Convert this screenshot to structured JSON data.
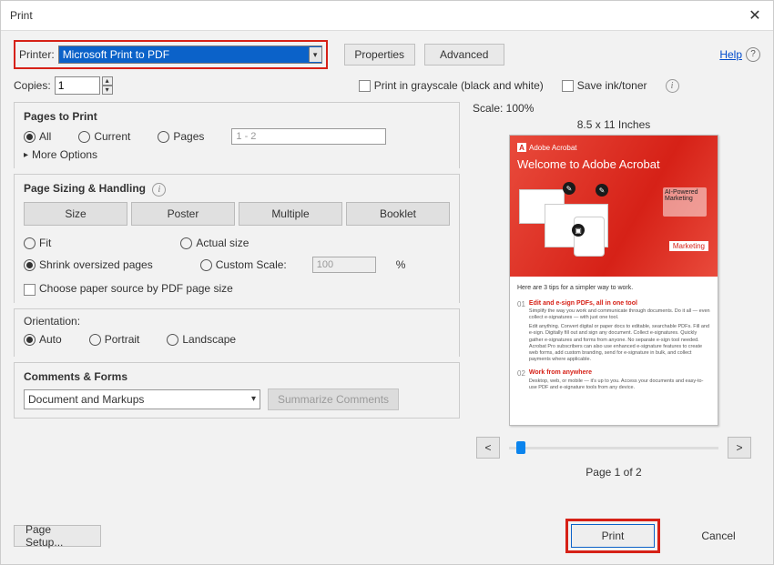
{
  "window": {
    "title": "Print"
  },
  "help": {
    "label": "Help"
  },
  "printer": {
    "label": "Printer:",
    "selected": "Microsoft Print to PDF"
  },
  "properties_btn": "Properties",
  "advanced_btn": "Advanced",
  "copies": {
    "label": "Copies:",
    "value": "1"
  },
  "grayscale_label": "Print in grayscale (black and white)",
  "saveink_label": "Save ink/toner",
  "pages_to_print": {
    "title": "Pages to Print",
    "all": "All",
    "current": "Current",
    "pages": "Pages",
    "range_placeholder": "1 - 2",
    "more_options": "More Options"
  },
  "sizing": {
    "title": "Page Sizing & Handling",
    "size": "Size",
    "poster": "Poster",
    "multiple": "Multiple",
    "booklet": "Booklet",
    "fit": "Fit",
    "actual": "Actual size",
    "shrink": "Shrink oversized pages",
    "custom": "Custom Scale:",
    "custom_value": "100",
    "percent": "%",
    "choose_source": "Choose paper source by PDF page size"
  },
  "orientation": {
    "title": "Orientation:",
    "auto": "Auto",
    "portrait": "Portrait",
    "landscape": "Landscape"
  },
  "comments": {
    "title": "Comments & Forms",
    "selected": "Document and Markups",
    "summarize": "Summarize Comments"
  },
  "preview": {
    "scale": "Scale: 100%",
    "paper": "8.5 x 11 Inches",
    "brand": "Adobe Acrobat",
    "welcome": "Welcome to Adobe Acrobat",
    "ai_badge": "AI-Powered Marketing",
    "marketing_tag": "Marketing",
    "tips_head": "Here are 3 tips for a simpler way to work.",
    "tip1_num": "01",
    "tip1_title": "Edit and e-sign PDFs, all in one tool",
    "tip1_text": "Simplify the way you work and communicate through documents. Do it all — even collect e-signatures — with just one tool.",
    "tip1_sub": "Edit anything. Convert digital or paper docs to editable, searchable PDFs. Fill and e-sign. Digitally fill out and sign any document. Collect e-signatures. Quickly gather e-signatures and forms from anyone. No separate e-sign tool needed. Acrobat Pro subscribers can also use enhanced e-signature features to create web forms, add custom branding, send for e-signature in bulk, and collect payments where applicable.",
    "tip2_num": "02",
    "tip2_title": "Work from anywhere",
    "tip2_text": "Desktop, web, or mobile — it's up to you. Access your documents and easy-to-use PDF and e-signature tools from any device.",
    "prev": "<",
    "next": ">",
    "page_indicator": "Page 1 of 2"
  },
  "footer": {
    "page_setup": "Page Setup...",
    "print": "Print",
    "cancel": "Cancel"
  }
}
